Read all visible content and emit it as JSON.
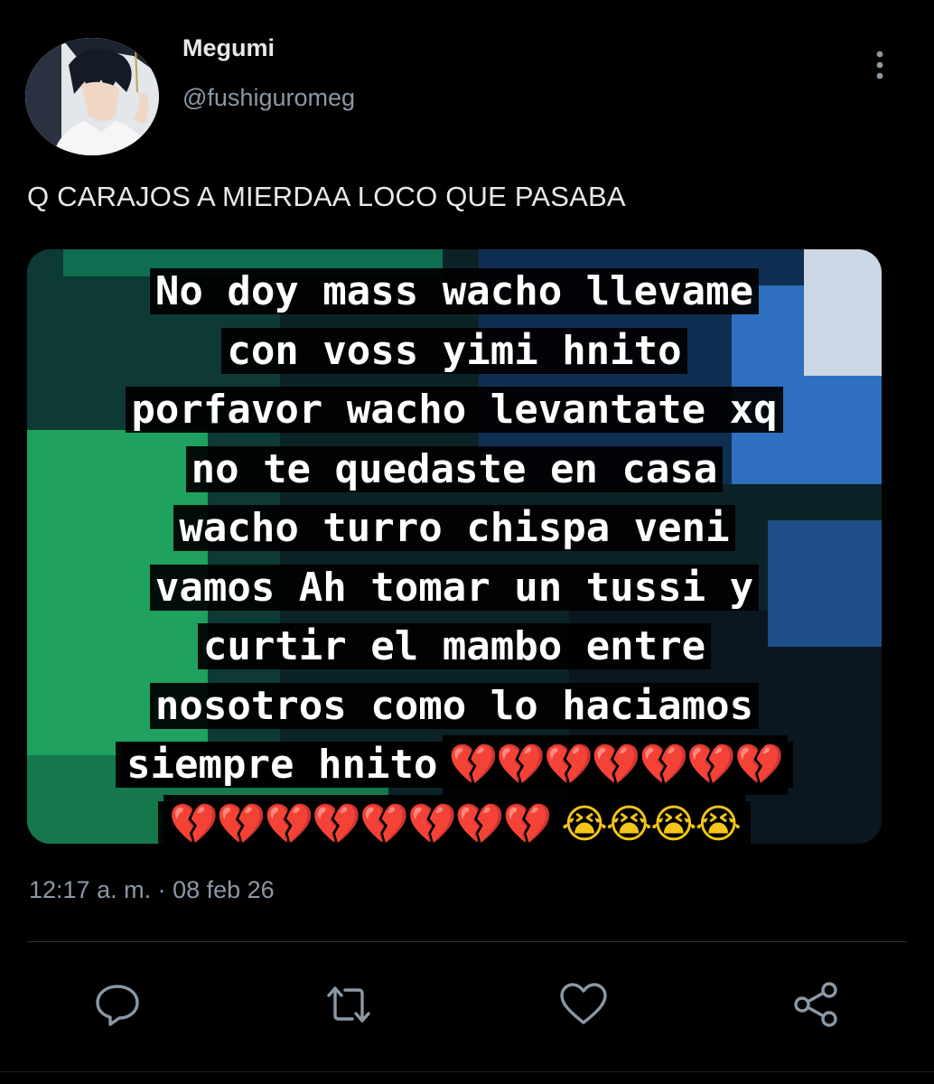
{
  "author": {
    "display_name": "Megumi",
    "handle": "@fushiguromeg"
  },
  "tweet": {
    "text": "Q CARAJOS A MIERDAA LOCO QUE PASABA",
    "timestamp": "12:17 a. m. · 08 feb 26"
  },
  "media": {
    "caption_lines": [
      "No doy mass wacho llevame",
      "con voss yimi hnito",
      "porfavor wacho levantate xq",
      "no te quedaste en casa",
      "wacho turro chispa veni",
      "vamos Ah tomar un tussi y",
      "curtir el mambo entre",
      "nosotros como lo haciamos",
      "siempre hnito"
    ],
    "emojis_line_9": "💔💔💔💔💔💔💔",
    "emojis_line_10_hearts": "💔💔💔💔💔💔💔💔",
    "emojis_line_10_faces": "😭😭😭😭"
  },
  "icons": {
    "more": "more-vertical-icon",
    "reply": "reply-icon",
    "retweet": "retweet-icon",
    "like": "like-icon",
    "share": "share-icon"
  },
  "colors": {
    "background": "#000000",
    "text_primary": "#e7e9ea",
    "text_secondary": "#8b98a5",
    "divider": "#2f3336"
  }
}
